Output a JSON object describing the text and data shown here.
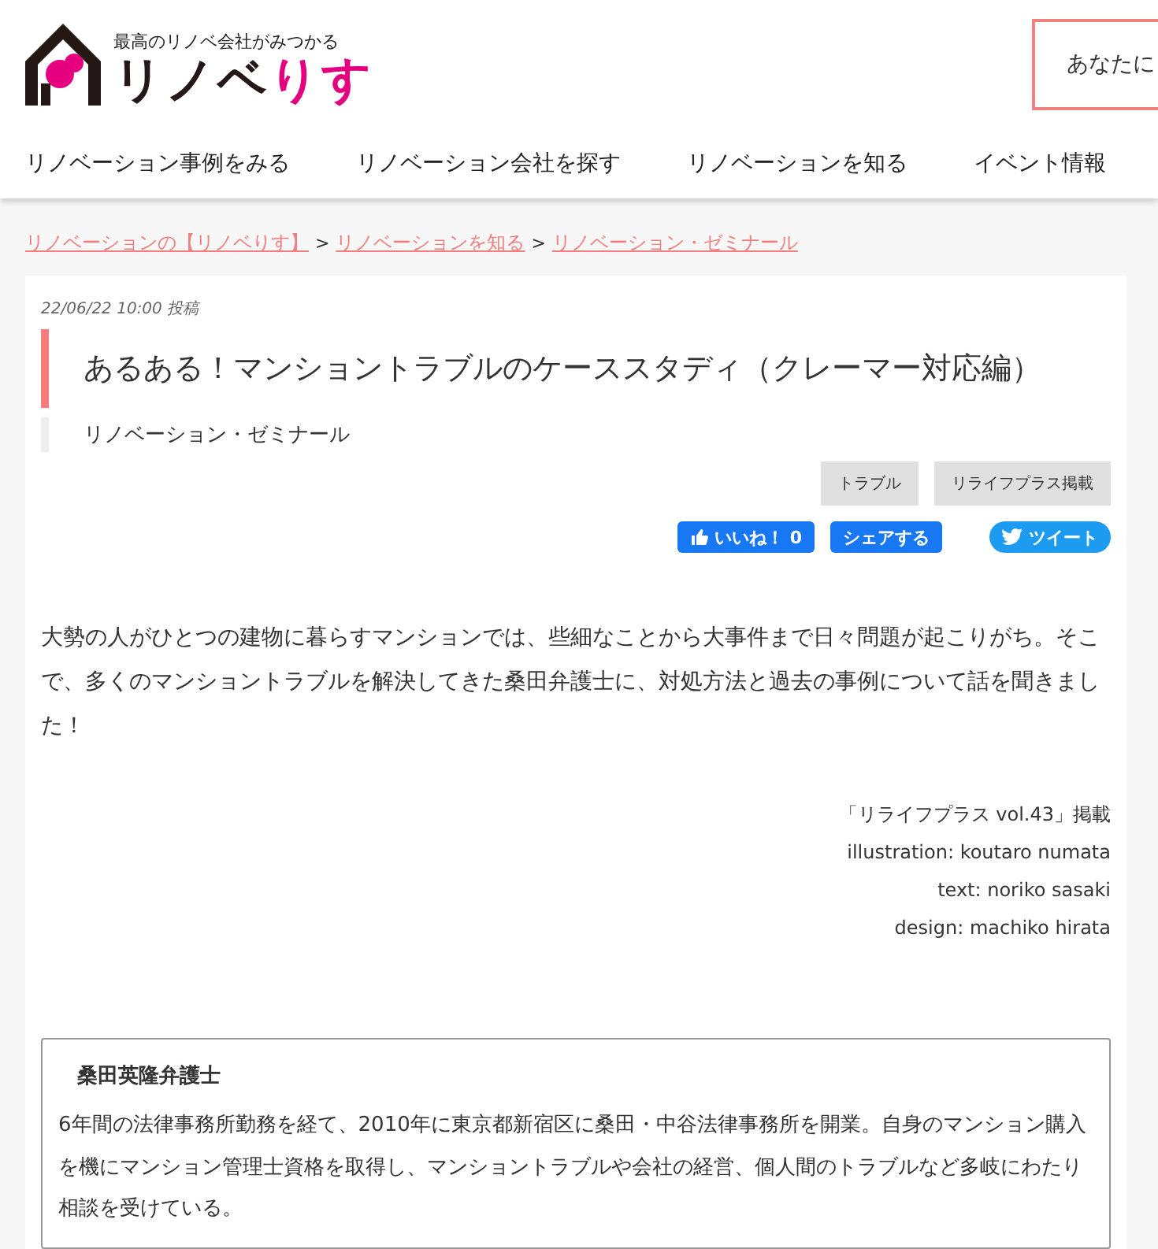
{
  "header": {
    "tagline": "最高のリノベ会社がみつかる",
    "logo_main": "リノベ",
    "logo_accent": "りす",
    "cta": "あなたに"
  },
  "nav": [
    "リノベーション事例をみる",
    "リノベーション会社を探す",
    "リノベーションを知る",
    "イベント情報"
  ],
  "breadcrumb": [
    "リノベーションの【リノベりす】",
    "リノベーションを知る",
    "リノベーション・ゼミナール"
  ],
  "breadcrumb_separators": [
    ">",
    ">"
  ],
  "article": {
    "posted": "22/06/22 10:00 投稿",
    "title": "あるある！マンショントラブルのケーススタディ（クレーマー対応編）",
    "category": "リノベーション・ゼミナール",
    "tags": [
      "トラブル",
      "リライフプラス掲載"
    ],
    "social": [
      {
        "kind": "like",
        "label": "いいね！ 0"
      },
      {
        "kind": "share",
        "label": "シェアする"
      },
      {
        "kind": "tweet",
        "label": "ツイート"
      }
    ],
    "lead": "大勢の人がひとつの建物に暮らすマンションでは、些細なことから大事件まで日々問題が起こりがち。そこで、多くのマンショントラブルを解決してきた桑田弁護士に、対処方法と過去の事例について話を聞きました！",
    "credits": [
      "「リライフプラス vol.43」掲載",
      "illustration: koutaro numata",
      "text: noriko sasaki",
      "design: machiko hirata"
    ],
    "profile": {
      "name": "桑田英隆弁護士",
      "bio": "6年間の法律事務所勤務を経て、2010年に東京都新宿区に桑田・中谷法律事務所を開業。自身のマンション購入を機にマンション管理士資格を取得し、マンショントラブルや会社の経営、個人間のトラブルなど多岐にわたり相談を受けている。"
    }
  }
}
